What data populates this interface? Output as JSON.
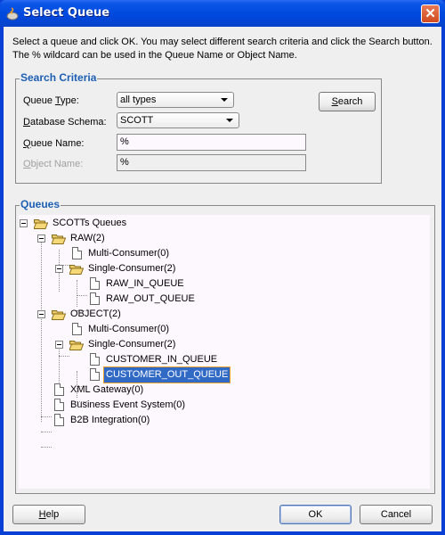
{
  "window": {
    "title": "Select Queue",
    "close_label": "✕"
  },
  "intro": {
    "line1": "Select a queue and click OK. You may select different search criteria and click the Search button.",
    "line2": "The % wildcard can be used in the Queue Name or Object Name."
  },
  "search_criteria": {
    "legend": "Search Criteria",
    "queue_type": {
      "label_pre": "Queue ",
      "label_mn": "T",
      "label_post": "ype:",
      "value": "all types"
    },
    "database_schema": {
      "label_pre": "",
      "label_mn": "D",
      "label_post": "atabase Schema:",
      "value": "SCOTT"
    },
    "queue_name": {
      "label_pre": "",
      "label_mn": "Q",
      "label_post": "ueue Name:",
      "value": "%"
    },
    "object_name": {
      "label_pre": "",
      "label_mn": "O",
      "label_post": "bject Name:",
      "value": "%",
      "disabled": true
    },
    "search_button": {
      "mn": "S",
      "rest": "earch"
    }
  },
  "queues": {
    "legend": "Queues",
    "tree": {
      "root": "SCOTTs Queues",
      "raw": "RAW(2)",
      "raw_multi": "Multi-Consumer(0)",
      "raw_single": "Single-Consumer(2)",
      "raw_in": "RAW_IN_QUEUE",
      "raw_out": "RAW_OUT_QUEUE",
      "object": "OBJECT(2)",
      "object_multi": "Multi-Consumer(0)",
      "object_single": "Single-Consumer(2)",
      "customer_in": "CUSTOMER_IN_QUEUE",
      "customer_out": "CUSTOMER_OUT_QUEUE",
      "xml_gateway": "XML Gateway(0)",
      "business_event": "Business Event System(0)",
      "b2b": "B2B Integration(0)"
    },
    "selected": "CUSTOMER_OUT_QUEUE"
  },
  "footer": {
    "help": {
      "mn": "H",
      "rest": "elp"
    },
    "ok": "OK",
    "cancel": "Cancel"
  }
}
